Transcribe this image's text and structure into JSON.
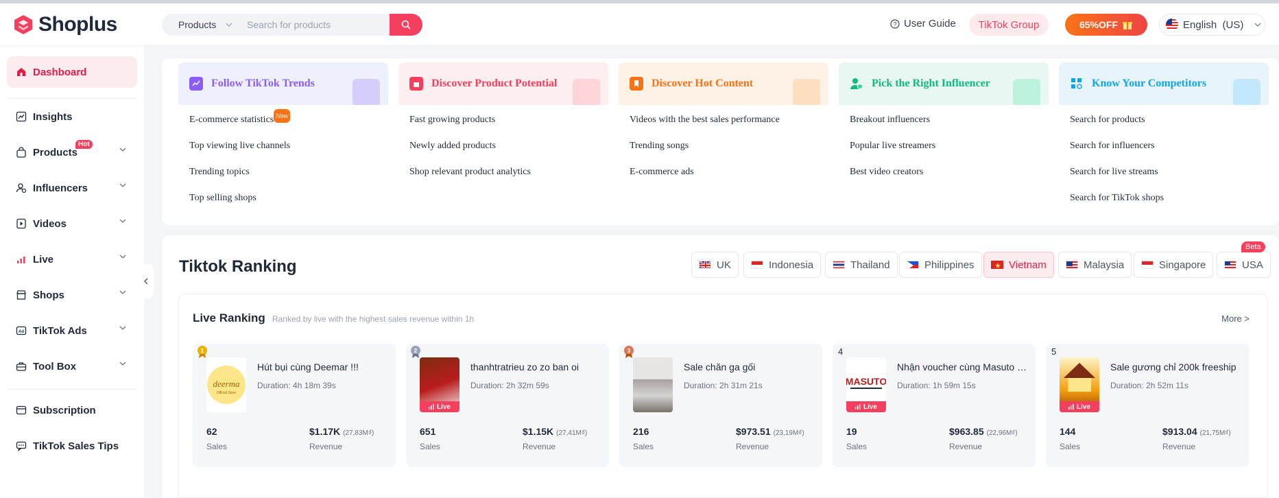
{
  "brand": {
    "name": "Shoplus",
    "color": "#f43f5e"
  },
  "search": {
    "category": "Products",
    "placeholder": "Search for products"
  },
  "header": {
    "user_guide": "User Guide",
    "tiktok_group": "TikTok Group",
    "promo": "65%OFF",
    "language": "English  (US)"
  },
  "sidebar": {
    "items": [
      {
        "label": "Dashboard",
        "icon": "home-icon",
        "active": true
      },
      {
        "label": "Insights",
        "icon": "chart-icon"
      },
      {
        "label": "Products",
        "icon": "bag-icon",
        "badge": "Hot"
      },
      {
        "label": "Influencers",
        "icon": "user-icon"
      },
      {
        "label": "Videos",
        "icon": "video-icon"
      },
      {
        "label": "Live",
        "icon": "live-icon"
      },
      {
        "label": "Shops",
        "icon": "shop-icon"
      },
      {
        "label": "TikTok Ads",
        "icon": "ads-icon"
      },
      {
        "label": "Tool Box",
        "icon": "toolbox-icon"
      },
      {
        "label": "Subscription",
        "icon": "subscription-icon"
      },
      {
        "label": "TikTok Sales Tips",
        "icon": "tips-icon"
      }
    ]
  },
  "features": [
    {
      "title": "Follow TikTok Trends",
      "color": "#8b5cf6",
      "links": [
        "E-commerce statistics",
        "Top viewing live channels",
        "Trending topics",
        "Top selling shops"
      ],
      "new_badge": "New"
    },
    {
      "title": "Discover Product Potential",
      "color": "#f43f5e",
      "links": [
        "Fast growing products",
        "Newly added products",
        "Shop relevant product analytics"
      ]
    },
    {
      "title": "Discover Hot Content",
      "color": "#f97316",
      "links": [
        "Videos with the best sales performance",
        "Trending songs",
        "E-commerce ads"
      ]
    },
    {
      "title": "Pick the Right Influencer",
      "color": "#10b981",
      "links": [
        "Breakout influencers",
        "Popular live streamers",
        "Best video creators"
      ]
    },
    {
      "title": "Know Your Competitors",
      "color": "#0ea5e9",
      "links": [
        "Search for products",
        "Search for influencers",
        "Search for live streams",
        "Search for TikTok shops"
      ]
    }
  ],
  "ranking": {
    "title": "Tiktok Ranking",
    "countries": [
      "UK",
      "Indonesia",
      "Thailand",
      "Philippines",
      "Vietnam",
      "Malaysia",
      "Singapore",
      "USA"
    ],
    "selected": "Vietnam",
    "beta": "Beta",
    "live": {
      "title": "Live Ranking",
      "subtitle": "Ranked by live with the highest sales revenue within 1h",
      "more": "More >",
      "sales_label": "Sales",
      "revenue_label": "Revenue",
      "live_tag": "Live",
      "items": [
        {
          "rank": "1",
          "title": "Hút bụi cùng Deemar !!!",
          "duration": "Duration:  4h 18m 39s",
          "sales": "62",
          "revenue": "$1.17K",
          "revenue_local": "(27,83M₫)"
        },
        {
          "rank": "2",
          "title": "thanhtratrieu zo zo ban oi",
          "duration": "Duration:  2h 32m 59s",
          "sales": "651",
          "revenue": "$1.15K",
          "revenue_local": "(27,41M₫)"
        },
        {
          "rank": "3",
          "title": "Sale chăn ga gối",
          "duration": "Duration:  2h 31m 21s",
          "sales": "216",
          "revenue": "$973.51",
          "revenue_local": "(23,19M₫)"
        },
        {
          "rank": "4",
          "title": "Nhận voucher cùng Masuto nhé",
          "duration": "Duration:  1h 59m 15s",
          "sales": "19",
          "revenue": "$963.85",
          "revenue_local": "(22,96M₫)"
        },
        {
          "rank": "5",
          "title": "Sale gương chỉ 200k freeship",
          "duration": "Duration:  2h 52m 11s",
          "sales": "144",
          "revenue": "$913.04",
          "revenue_local": "(21,75M₫)"
        }
      ]
    }
  }
}
